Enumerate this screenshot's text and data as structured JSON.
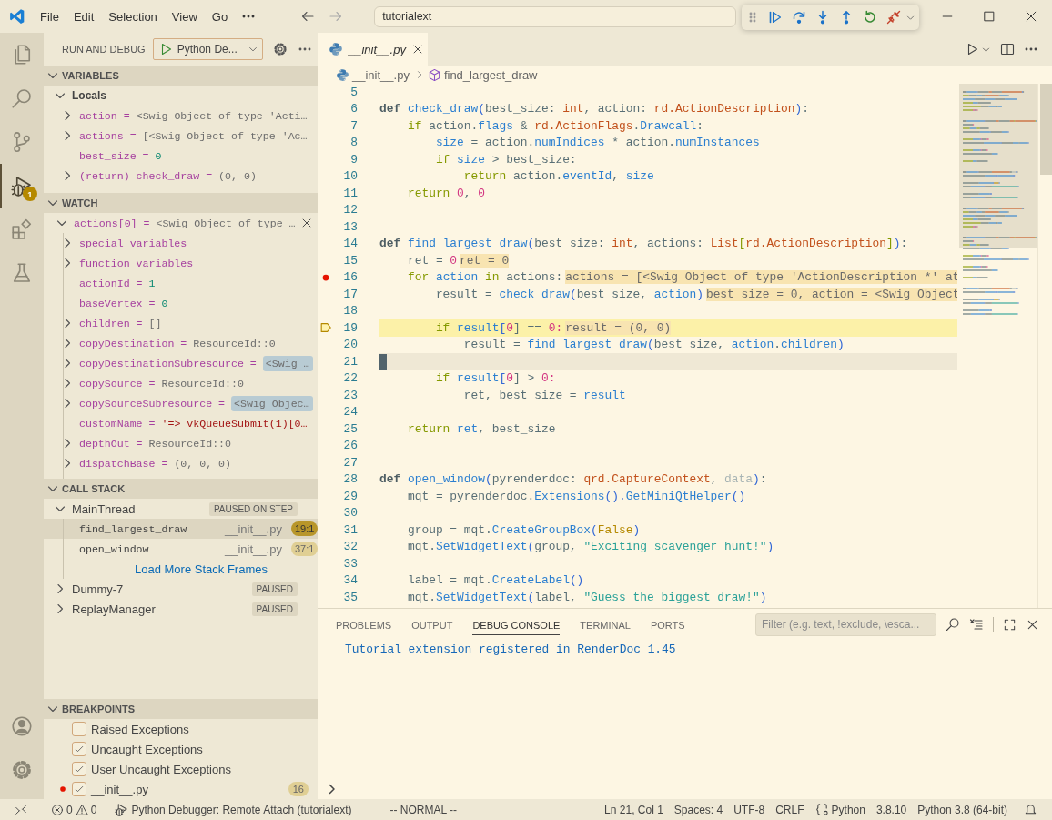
{
  "title_bar": {
    "menus": [
      "File",
      "Edit",
      "Selection",
      "View",
      "Go"
    ],
    "search": {
      "value": "tutorialext"
    }
  },
  "debug_toolbar": {
    "actions": [
      {
        "kind": "continue"
      },
      {
        "kind": "step-over"
      },
      {
        "kind": "step-into"
      },
      {
        "kind": "step-out"
      },
      {
        "kind": "restart"
      },
      {
        "kind": "disconnect"
      }
    ]
  },
  "activity_bar": {
    "items": [
      {
        "kind": "explorer",
        "selected": false
      },
      {
        "kind": "search",
        "selected": false
      },
      {
        "kind": "source-control",
        "selected": false
      },
      {
        "kind": "run-debug",
        "selected": true,
        "badge": "1"
      },
      {
        "kind": "extensions",
        "selected": false
      },
      {
        "kind": "testing",
        "selected": false
      }
    ],
    "bottom": [
      {
        "kind": "accounts"
      },
      {
        "kind": "manage"
      }
    ]
  },
  "sidebar": {
    "title": "RUN AND DEBUG",
    "configuration": "Python De...",
    "variables": {
      "title": "VARIABLES",
      "expanded": true,
      "scope": {
        "name": "Locals",
        "expanded": true
      },
      "rows": [
        {
          "name": "action =",
          "value": "<Swig Object of type 'Acti…",
          "kind": "object",
          "expandable": true,
          "changed": false
        },
        {
          "name": "actions =",
          "value": "[<Swig Object of type 'Ac…",
          "kind": "object",
          "expandable": true,
          "changed": false
        },
        {
          "name": "best_size =",
          "value": "0",
          "kind": "number",
          "expandable": false,
          "changed": false
        },
        {
          "name": "(return) check_draw =",
          "value": "(0, 0)",
          "kind": "object",
          "expandable": true,
          "changed": false
        }
      ]
    },
    "watch": {
      "title": "WATCH",
      "expanded": true,
      "expression": {
        "name": "actions[0] =",
        "value": "<Swig Object of type …",
        "expanded": true,
        "children": [
          {
            "name": "special variables",
            "expandable": true,
            "changed": false
          },
          {
            "name": "function variables",
            "expandable": true,
            "changed": false
          },
          {
            "name": "actionId =",
            "value": "1",
            "kind": "number",
            "expandable": false,
            "changed": false
          },
          {
            "name": "baseVertex =",
            "value": "0",
            "kind": "number",
            "expandable": false,
            "changed": false
          },
          {
            "name": "children =",
            "value": "[]",
            "kind": "object",
            "expandable": true,
            "changed": false
          },
          {
            "name": "copyDestination =",
            "value": "ResourceId::0",
            "kind": "object",
            "expandable": true,
            "changed": false
          },
          {
            "name": "copyDestinationSubresource =",
            "value": "<Swig …",
            "kind": "object",
            "expandable": true,
            "changed": true
          },
          {
            "name": "copySource =",
            "value": "ResourceId::0",
            "kind": "object",
            "expandable": true,
            "changed": false
          },
          {
            "name": "copySourceSubresource =",
            "value": "<Swig Objec…",
            "kind": "object",
            "expandable": true,
            "changed": true
          },
          {
            "name": "customName =",
            "value": "'=> vkQueueSubmit(1)[0…",
            "kind": "string",
            "expandable": false,
            "changed": false
          },
          {
            "name": "depthOut =",
            "value": "ResourceId::0",
            "kind": "object",
            "expandable": true,
            "changed": false
          },
          {
            "name": "dispatchBase =",
            "value": "(0, 0, 0)",
            "kind": "object",
            "expandable": true,
            "changed": false
          }
        ]
      }
    },
    "call_stack": {
      "title": "CALL STACK",
      "expanded": true,
      "threads": [
        {
          "name": "MainThread",
          "status": "PAUSED ON STEP",
          "expanded": true,
          "frames": [
            {
              "name": "find_largest_draw",
              "file": "__init__.py",
              "position": "19:1",
              "selected": true
            },
            {
              "name": "open_window",
              "file": "__init__.py",
              "position": "37:1",
              "selected": false
            }
          ],
          "more_link": "Load More Stack Frames"
        },
        {
          "name": "Dummy-7",
          "status": "PAUSED",
          "expanded": false
        },
        {
          "name": "ReplayManager",
          "status": "PAUSED",
          "expanded": false
        }
      ]
    },
    "breakpoints": {
      "title": "BREAKPOINTS",
      "expanded": true,
      "items": [
        {
          "label": "Raised Exceptions",
          "checked": false,
          "kind": "exception"
        },
        {
          "label": "Uncaught Exceptions",
          "checked": true,
          "kind": "exception"
        },
        {
          "label": "User Uncaught Exceptions",
          "checked": true,
          "kind": "exception"
        },
        {
          "label": "__init__.py",
          "checked": true,
          "kind": "file",
          "line": "16"
        }
      ]
    }
  },
  "editor": {
    "tabs": [
      {
        "label": "__init__.py",
        "selected": true
      }
    ],
    "breadcrumbs": [
      {
        "label": "__init__.py",
        "kind": "file"
      },
      {
        "label": "find_largest_draw",
        "kind": "function"
      }
    ],
    "lines": [
      {
        "number": "5",
        "kind": "blank"
      },
      {
        "number": "6",
        "kind": "code",
        "tokens": [
          {
            "text": "def ",
            "kind": "def"
          },
          {
            "text": "check_draw",
            "kind": "function"
          },
          {
            "text": "(",
            "kind": "bracket"
          },
          {
            "text": "best_size: ",
            "kind": "plain"
          },
          {
            "text": "int",
            "kind": "type"
          },
          {
            "text": ", action: ",
            "kind": "plain"
          },
          {
            "text": "rd.ActionDescription",
            "kind": "type"
          },
          {
            "text": ")",
            "kind": "bracket"
          },
          {
            "text": ":",
            "kind": "plain"
          }
        ]
      },
      {
        "number": "7",
        "kind": "code",
        "tokens": [
          {
            "text": "    if",
            "kind": "keyword"
          },
          {
            "text": " action.",
            "kind": "plain"
          },
          {
            "text": "flags",
            "kind": "member"
          },
          {
            "text": " & ",
            "kind": "plain"
          },
          {
            "text": "rd.ActionFlags",
            "kind": "type"
          },
          {
            "text": ".",
            "kind": "plain"
          },
          {
            "text": "Drawcall",
            "kind": "member"
          },
          {
            "text": ":",
            "kind": "plain"
          }
        ]
      },
      {
        "number": "8",
        "kind": "code",
        "tokens": [
          {
            "text": "        size",
            "kind": "member"
          },
          {
            "text": " = action.",
            "kind": "plain"
          },
          {
            "text": "numIndices",
            "kind": "member"
          },
          {
            "text": " * action.",
            "kind": "plain"
          },
          {
            "text": "numInstances",
            "kind": "member"
          }
        ]
      },
      {
        "number": "9",
        "kind": "code",
        "tokens": [
          {
            "text": "        if",
            "kind": "keyword"
          },
          {
            "text": " size",
            "kind": "member"
          },
          {
            "text": " > best_size:",
            "kind": "plain"
          }
        ]
      },
      {
        "number": "10",
        "kind": "code",
        "tokens": [
          {
            "text": "            return",
            "kind": "keyword"
          },
          {
            "text": " action.",
            "kind": "plain"
          },
          {
            "text": "eventId",
            "kind": "member"
          },
          {
            "text": ", ",
            "kind": "plain"
          },
          {
            "text": "size",
            "kind": "member"
          }
        ]
      },
      {
        "number": "11",
        "kind": "code",
        "tokens": [
          {
            "text": "    return",
            "kind": "keyword"
          },
          {
            "text": " 0",
            "kind": "number"
          },
          {
            "text": ", ",
            "kind": "plain"
          },
          {
            "text": "0",
            "kind": "number"
          }
        ]
      },
      {
        "number": "12",
        "kind": "blank"
      },
      {
        "number": "13",
        "kind": "blank"
      },
      {
        "number": "14",
        "kind": "code",
        "tokens": [
          {
            "text": "def ",
            "kind": "def"
          },
          {
            "text": "find_largest_draw",
            "kind": "function"
          },
          {
            "text": "(",
            "kind": "bracket"
          },
          {
            "text": "best_size: ",
            "kind": "plain"
          },
          {
            "text": "int",
            "kind": "type"
          },
          {
            "text": ", actions: ",
            "kind": "plain"
          },
          {
            "text": "List",
            "kind": "type"
          },
          {
            "text": "[",
            "kind": "bracket2"
          },
          {
            "text": "rd.ActionDescription",
            "kind": "type"
          },
          {
            "text": "]",
            "kind": "bracket2"
          },
          {
            "text": ")",
            "kind": "bracket"
          },
          {
            "text": ":",
            "kind": "plain"
          }
        ]
      },
      {
        "number": "15",
        "kind": "code",
        "tokens": [
          {
            "text": "    ret = ",
            "kind": "plain"
          },
          {
            "text": "0",
            "kind": "number"
          }
        ],
        "inline_value": "ret = 0"
      },
      {
        "number": "16",
        "kind": "breakpoint",
        "tokens": [
          {
            "text": "    for",
            "kind": "keyword"
          },
          {
            "text": " action",
            "kind": "member"
          },
          {
            "text": " in",
            "kind": "keyword"
          },
          {
            "text": " actions:",
            "kind": "plain"
          }
        ],
        "inline_value": "actions = [<Swig Object of type 'ActionDescription *' at"
      },
      {
        "number": "17",
        "kind": "code",
        "tokens": [
          {
            "text": "        result = ",
            "kind": "plain"
          },
          {
            "text": "check_draw",
            "kind": "function"
          },
          {
            "text": "(",
            "kind": "bracket"
          },
          {
            "text": "best_size, ",
            "kind": "plain"
          },
          {
            "text": "action",
            "kind": "member"
          },
          {
            "text": ")",
            "kind": "bracket"
          }
        ],
        "inline_value": "best_size = 0, action = <Swig Object"
      },
      {
        "number": "18",
        "kind": "blank"
      },
      {
        "number": "19",
        "kind": "current",
        "tokens": [
          {
            "text": "        if",
            "kind": "keyword"
          },
          {
            "text": " result",
            "kind": "member"
          },
          {
            "text": "[",
            "kind": "bracket"
          },
          {
            "text": "0",
            "kind": "number"
          },
          {
            "text": "] == ",
            "kind": "plain"
          },
          {
            "text": "0:",
            "kind": "number"
          }
        ],
        "inline_value": "result = (0, 0)"
      },
      {
        "number": "20",
        "kind": "code",
        "tokens": [
          {
            "text": "            result = ",
            "kind": "plain"
          },
          {
            "text": "find_largest_draw",
            "kind": "function"
          },
          {
            "text": "(",
            "kind": "bracket"
          },
          {
            "text": "best_size, ",
            "kind": "plain"
          },
          {
            "text": "action",
            "kind": "member"
          },
          {
            "text": ".",
            "kind": "plain"
          },
          {
            "text": "children",
            "kind": "member"
          },
          {
            "text": ")",
            "kind": "bracket"
          }
        ]
      },
      {
        "number": "21",
        "kind": "cursor"
      },
      {
        "number": "22",
        "kind": "code",
        "tokens": [
          {
            "text": "        if",
            "kind": "keyword"
          },
          {
            "text": " result",
            "kind": "member"
          },
          {
            "text": "[",
            "kind": "bracket"
          },
          {
            "text": "0",
            "kind": "number"
          },
          {
            "text": "] > ",
            "kind": "plain"
          },
          {
            "text": "0:",
            "kind": "number"
          }
        ]
      },
      {
        "number": "23",
        "kind": "code",
        "tokens": [
          {
            "text": "            ret, best_size = ",
            "kind": "plain"
          },
          {
            "text": "result",
            "kind": "member"
          }
        ]
      },
      {
        "number": "24",
        "kind": "blank"
      },
      {
        "number": "25",
        "kind": "code",
        "tokens": [
          {
            "text": "    return",
            "kind": "keyword"
          },
          {
            "text": " ret",
            "kind": "member"
          },
          {
            "text": ", best_size",
            "kind": "plain"
          }
        ]
      },
      {
        "number": "26",
        "kind": "blank"
      },
      {
        "number": "27",
        "kind": "blank"
      },
      {
        "number": "28",
        "kind": "code",
        "tokens": [
          {
            "text": "def ",
            "kind": "def"
          },
          {
            "text": "open_window",
            "kind": "function"
          },
          {
            "text": "(",
            "kind": "bracket"
          },
          {
            "text": "pyrenderdoc: ",
            "kind": "plain"
          },
          {
            "text": "qrd.CaptureContext",
            "kind": "type"
          },
          {
            "text": ", ",
            "kind": "plain"
          },
          {
            "text": "data",
            "kind": "unused"
          },
          {
            "text": ")",
            "kind": "bracket"
          },
          {
            "text": ":",
            "kind": "plain"
          }
        ]
      },
      {
        "number": "29",
        "kind": "code",
        "tokens": [
          {
            "text": "    mqt = pyrenderdoc.",
            "kind": "plain"
          },
          {
            "text": "Extensions",
            "kind": "function"
          },
          {
            "text": "().",
            "kind": "bracket"
          },
          {
            "text": "GetMiniQtHelper",
            "kind": "function"
          },
          {
            "text": "()",
            "kind": "bracket"
          }
        ]
      },
      {
        "number": "30",
        "kind": "blank"
      },
      {
        "number": "31",
        "kind": "code",
        "tokens": [
          {
            "text": "    group = mqt.",
            "kind": "plain"
          },
          {
            "text": "CreateGroupBox",
            "kind": "function"
          },
          {
            "text": "(",
            "kind": "bracket"
          },
          {
            "text": "False",
            "kind": "constant"
          },
          {
            "text": ")",
            "kind": "bracket"
          }
        ]
      },
      {
        "number": "32",
        "kind": "code",
        "tokens": [
          {
            "text": "    mqt.",
            "kind": "plain"
          },
          {
            "text": "SetWidgetText",
            "kind": "function"
          },
          {
            "text": "(",
            "kind": "bracket"
          },
          {
            "text": "group, ",
            "kind": "plain"
          },
          {
            "text": "\"Exciting scavenger hunt!\"",
            "kind": "string"
          },
          {
            "text": ")",
            "kind": "bracket"
          }
        ]
      },
      {
        "number": "33",
        "kind": "blank"
      },
      {
        "number": "34",
        "kind": "code",
        "tokens": [
          {
            "text": "    label = mqt.",
            "kind": "plain"
          },
          {
            "text": "CreateLabel",
            "kind": "function"
          },
          {
            "text": "()",
            "kind": "bracket"
          }
        ]
      },
      {
        "number": "35",
        "kind": "code",
        "tokens": [
          {
            "text": "    mqt.",
            "kind": "plain"
          },
          {
            "text": "SetWidgetText",
            "kind": "function"
          },
          {
            "text": "(",
            "kind": "bracket"
          },
          {
            "text": "label, ",
            "kind": "plain"
          },
          {
            "text": "\"Guess the biggest draw!\"",
            "kind": "string"
          },
          {
            "text": ")",
            "kind": "bracket"
          }
        ]
      }
    ]
  },
  "panel": {
    "tabs": [
      {
        "label": "PROBLEMS",
        "selected": false
      },
      {
        "label": "OUTPUT",
        "selected": false
      },
      {
        "label": "DEBUG CONSOLE",
        "selected": true
      },
      {
        "label": "TERMINAL",
        "selected": false
      },
      {
        "label": "PORTS",
        "selected": false
      }
    ],
    "filter": {
      "placeholder": "Filter (e.g. text, !exclude, \\esca..."
    },
    "output": [
      "Tutorial extension registered in RenderDoc 1.45"
    ]
  },
  "status_bar": {
    "left": [
      {
        "kind": "remote"
      },
      {
        "kind": "problems",
        "errors": "0",
        "warnings": "0"
      },
      {
        "kind": "debug",
        "text": "Python Debugger: Remote Attach (tutorialext)"
      },
      {
        "kind": "text",
        "text": "-- NORMAL --"
      }
    ],
    "right": [
      {
        "kind": "text",
        "text": "Ln 21, Col 1"
      },
      {
        "kind": "text",
        "text": "Spaces: 4"
      },
      {
        "kind": "text",
        "text": "UTF-8"
      },
      {
        "kind": "text",
        "text": "CRLF"
      },
      {
        "kind": "language",
        "text": "Python"
      },
      {
        "kind": "text",
        "text": "3.8.10"
      },
      {
        "kind": "text",
        "text": "Python 3.8 (64-bit)"
      },
      {
        "kind": "bell"
      }
    ]
  }
}
